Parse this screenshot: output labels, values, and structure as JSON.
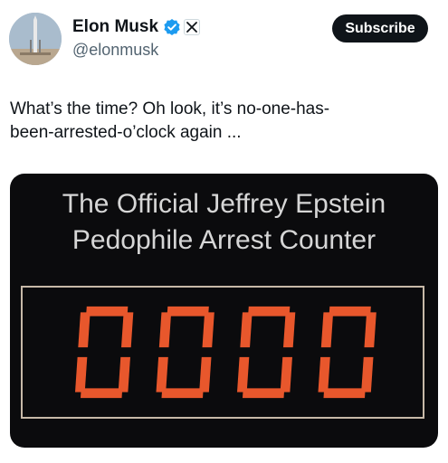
{
  "author": {
    "name": "Elon Musk",
    "handle": "@elonmusk",
    "verified_color": "#1d9bf0",
    "avatar_icon": "rocket-avatar"
  },
  "actions": {
    "subscribe_label": "Subscribe"
  },
  "tweet": {
    "text_line1": "What’s the time? Oh look, it’s no-one-has-",
    "text_line2": "been-arrested-o’clock again ..."
  },
  "media": {
    "title_line1": "The Official Jeffrey Epstein",
    "title_line2": "Pedophile Arrest Counter",
    "counter_value": "0000",
    "digit_color": "#e8572c",
    "background_color": "#0b0b0d"
  }
}
